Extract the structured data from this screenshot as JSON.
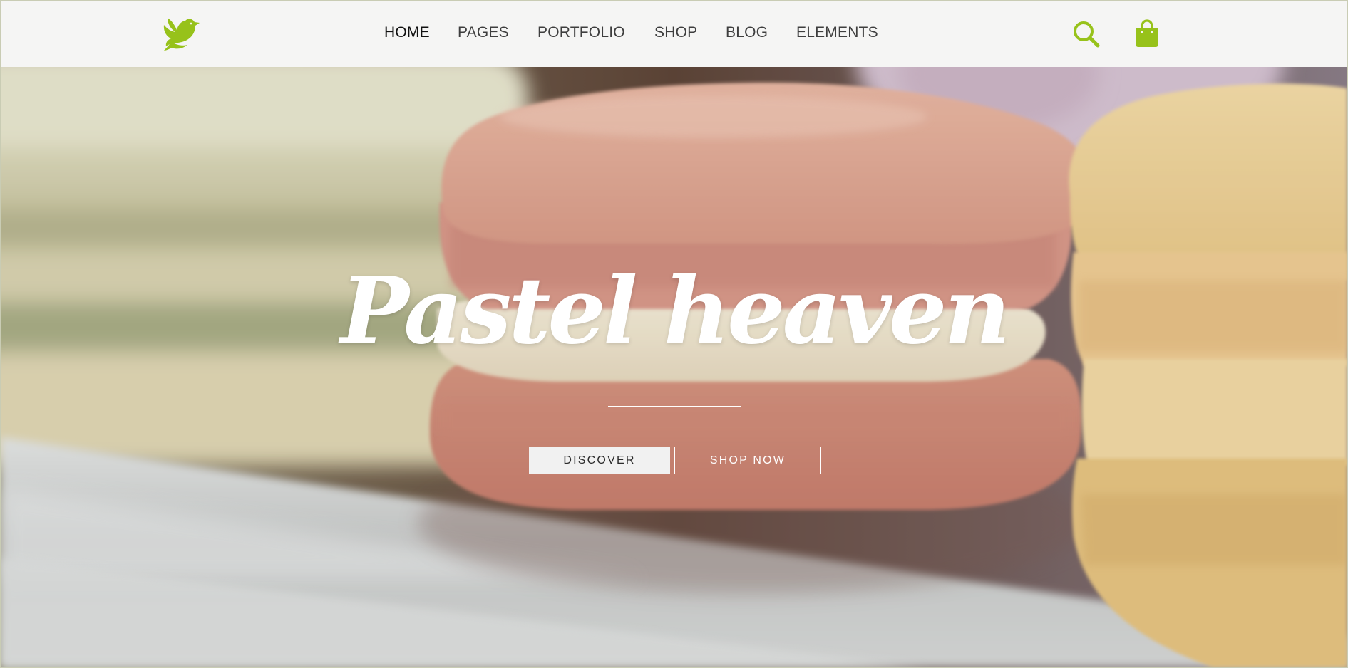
{
  "header": {
    "logo_name": "dove-logo",
    "nav": [
      {
        "label": "HOME",
        "active": true
      },
      {
        "label": "PAGES",
        "active": false
      },
      {
        "label": "PORTFOLIO",
        "active": false
      },
      {
        "label": "SHOP",
        "active": false
      },
      {
        "label": "BLOG",
        "active": false
      },
      {
        "label": "ELEMENTS",
        "active": false
      }
    ],
    "icons": [
      "search-icon",
      "shopping-bag-icon"
    ]
  },
  "hero": {
    "title": "Pastel heaven",
    "buttons": {
      "discover": "DISCOVER",
      "shop_now": "SHOP NOW"
    }
  },
  "colors": {
    "accent": "#97c21a",
    "header_bg": "#f5f5f4",
    "nav_text": "#3e3e3e"
  }
}
